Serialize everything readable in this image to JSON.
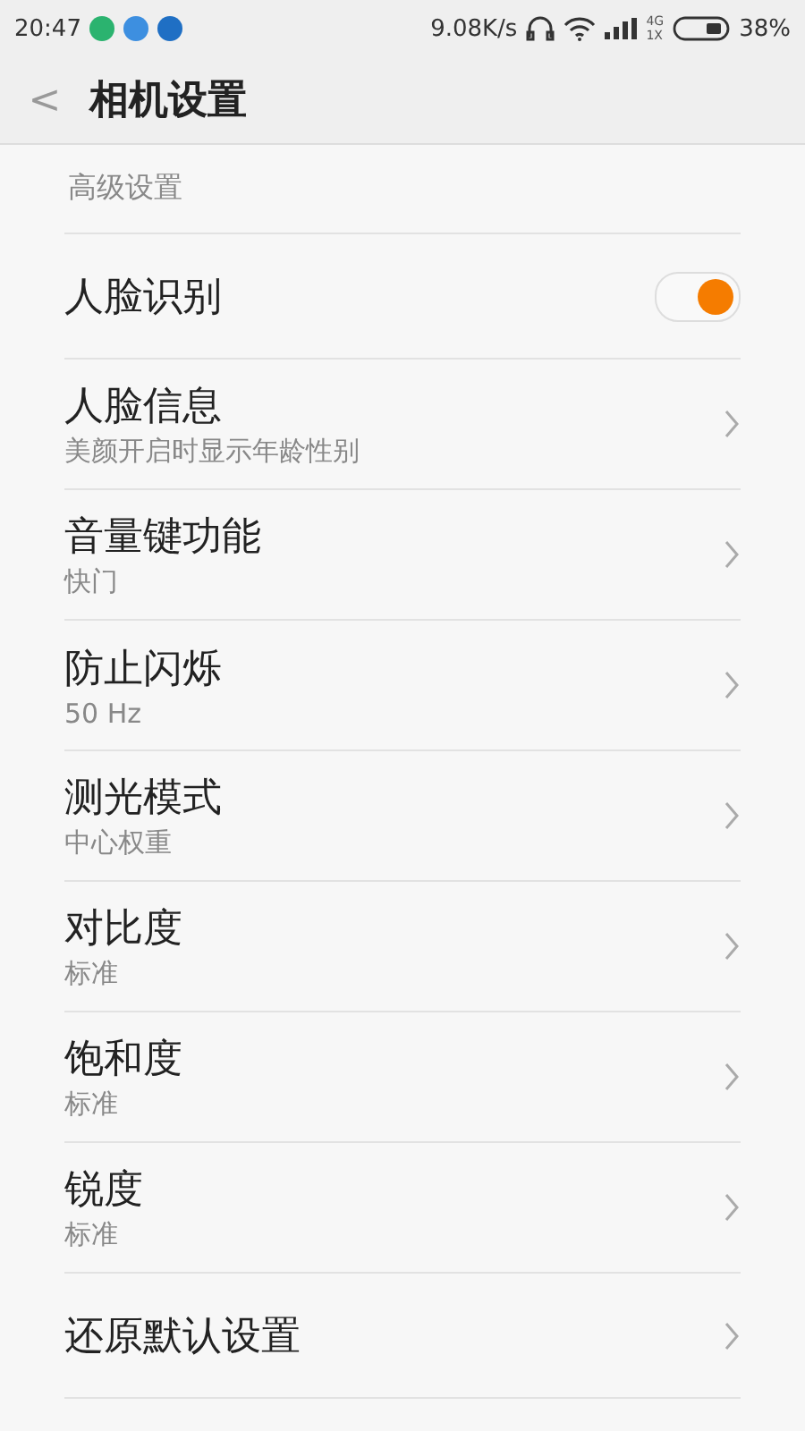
{
  "status_bar": {
    "time": "20:47",
    "speed": "9.08K/s",
    "network_top": "4G",
    "network_bottom": "1X",
    "battery": "38%",
    "notifications": [
      {
        "color": "#2bb36f"
      },
      {
        "color": "#3d8fe0"
      },
      {
        "color": "#1f6fc4"
      }
    ]
  },
  "header": {
    "back": "<",
    "title": "相机设置"
  },
  "section": {
    "title": "高级设置"
  },
  "items": [
    {
      "kind": "toggle",
      "title": "人脸识别",
      "on": true
    },
    {
      "kind": "link",
      "title": "人脸信息",
      "subtitle": "美颜开启时显示年龄性别"
    },
    {
      "kind": "link",
      "title": "音量键功能",
      "subtitle": "快门"
    },
    {
      "kind": "link",
      "title": "防止闪烁",
      "subtitle": "50 Hz"
    },
    {
      "kind": "link",
      "title": "测光模式",
      "subtitle": "中心权重"
    },
    {
      "kind": "link",
      "title": "对比度",
      "subtitle": "标准"
    },
    {
      "kind": "link",
      "title": "饱和度",
      "subtitle": "标准"
    },
    {
      "kind": "link",
      "title": "锐度",
      "subtitle": "标准"
    },
    {
      "kind": "link",
      "title": "还原默认设置"
    }
  ]
}
